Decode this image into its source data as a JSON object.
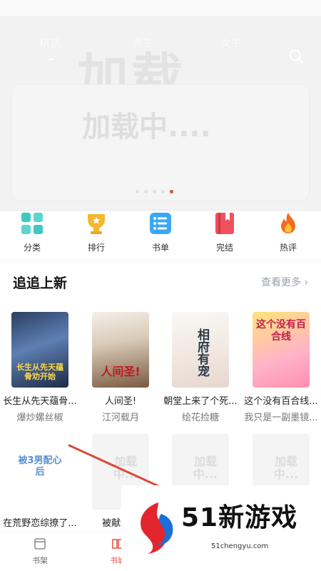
{
  "header": {
    "tabs": [
      "精选",
      "男生",
      "女生"
    ],
    "active_tab": 0,
    "watermark": "加载",
    "search_icon": "search-icon"
  },
  "banner": {
    "loading_text": "加载中....",
    "dots_total": 5,
    "dots_active": 4,
    "accent": "#e74a3b"
  },
  "categories": [
    {
      "label": "分类",
      "icon": "grid-icon"
    },
    {
      "label": "排行",
      "icon": "trophy-icon"
    },
    {
      "label": "书单",
      "icon": "list-icon"
    },
    {
      "label": "完结",
      "icon": "book-icon"
    },
    {
      "label": "热评",
      "icon": "flame-icon"
    }
  ],
  "section": {
    "title": "追追上新",
    "more": "查看更多 ›"
  },
  "books_row1": [
    {
      "title": "长生从先天蕴骨...",
      "author": "爆炒螺丝椒",
      "cover_text": "长生从先天蕴骨劝开始"
    },
    {
      "title": "人间圣!",
      "author": "江河载月",
      "cover_text": "人间圣!"
    },
    {
      "title": "朝堂上来了个死...",
      "author": "绘花捡糖",
      "cover_text": "相府有宠"
    },
    {
      "title": "这个没有百合线...",
      "author": "我只是一副墨镜...",
      "cover_text": "这个没有百合线"
    }
  ],
  "books_row2": [
    {
      "title": "在荒野恋综撩了...",
      "cover_text": "被3男配心后"
    },
    {
      "title": "被献给暴",
      "placeholder": "加载中..."
    },
    {
      "title": "",
      "placeholder": "加载中..."
    },
    {
      "title": "",
      "placeholder": "加载中..."
    }
  ],
  "bottom_nav": [
    {
      "label": "书架",
      "icon": "bookshelf-icon"
    },
    {
      "label": "书城",
      "icon": "bookstore-icon"
    }
  ],
  "watermark_brand": {
    "number": "51新游戏",
    "url": "51chengyu.com"
  }
}
